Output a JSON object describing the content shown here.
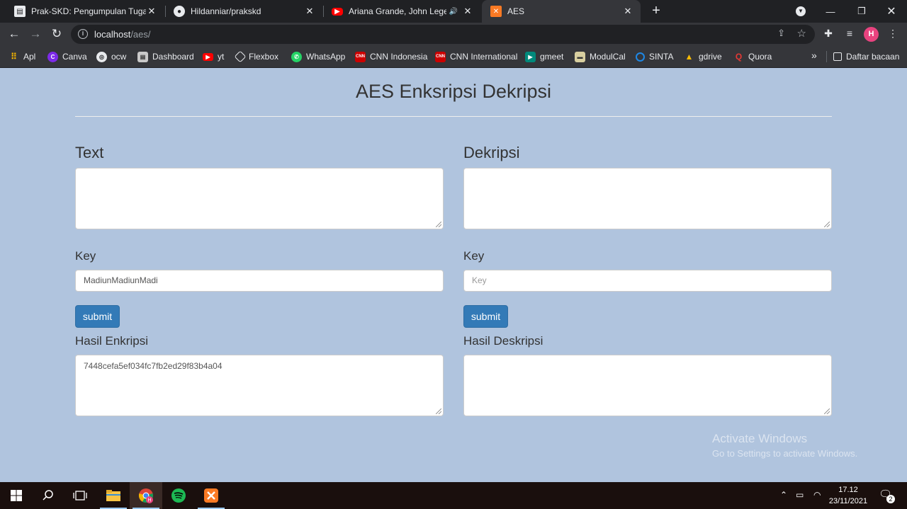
{
  "browser": {
    "tabs": [
      {
        "title": "Prak-SKD: Pengumpulan Tugas T",
        "icon": "document-icon"
      },
      {
        "title": "Hildanniar/prakskd",
        "icon": "github-icon"
      },
      {
        "title": "Ariana Grande, John Legend",
        "icon": "youtube-icon"
      },
      {
        "title": "AES",
        "icon": "xampp-icon",
        "active": true
      }
    ],
    "address": {
      "host": "localhost",
      "path": "/aes/"
    },
    "profile_initial": "H",
    "bookmarks": [
      "Apl",
      "Canva",
      "ocw",
      "Dashboard",
      "yt",
      "Flexbox",
      "WhatsApp",
      "CNN Indonesia",
      "CNN International",
      "gmeet",
      "ModulCal",
      "SINTA",
      "gdrive",
      "Quora"
    ],
    "reading_list": "Daftar bacaan"
  },
  "page": {
    "title": "AES Enksripsi Dekripsi",
    "encrypt": {
      "heading": "Text",
      "text_value": "",
      "key_label": "Key",
      "key_value": "MadiunMadiunMadi",
      "submit_label": "submit",
      "result_label": "Hasil Enkripsi",
      "result_value": "7448cefa5ef034fc7fb2ed29f83b4a04"
    },
    "decrypt": {
      "heading": "Dekripsi",
      "text_value": "",
      "key_label": "Key",
      "key_placeholder": "Key",
      "submit_label": "submit",
      "result_label": "Hasil Deskripsi",
      "result_value": ""
    }
  },
  "watermark": {
    "line1": "Activate Windows",
    "line2": "Go to Settings to activate Windows."
  },
  "taskbar": {
    "time": "17.12",
    "date": "23/11/2021",
    "notification_count": "2"
  },
  "colors": {
    "page_bg": "#b0c4de",
    "button": "#337ab7",
    "chrome_dark": "#202124",
    "chrome_toolbar": "#35363a"
  }
}
